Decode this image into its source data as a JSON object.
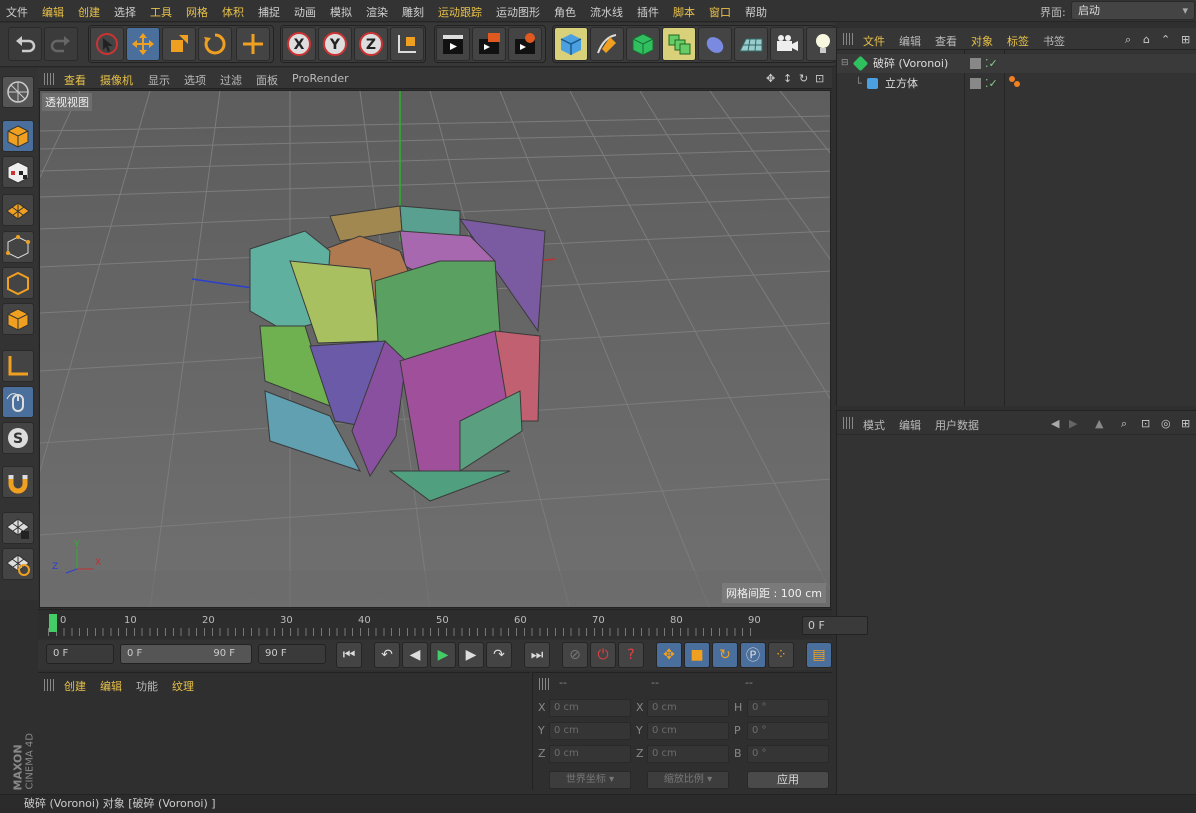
{
  "menubar": {
    "items": [
      "文件",
      "编辑",
      "创建",
      "选择",
      "工具",
      "网格",
      "体积",
      "捕捉",
      "动画",
      "模拟",
      "渲染",
      "雕刻",
      "运动跟踪",
      "运动图形",
      "角色",
      "流水线",
      "插件",
      "脚本",
      "窗口",
      "帮助"
    ],
    "highlight": [
      "编辑",
      "创建",
      "工具",
      "网格",
      "体积",
      "运动跟踪",
      "脚本",
      "窗口"
    ],
    "layout_label": "界面:",
    "layout_value": "启动"
  },
  "toolbar": {
    "icons": [
      "undo-icon",
      "redo-icon",
      "live-select-icon",
      "move-icon",
      "scale-icon",
      "rotate-icon",
      "transform-icon",
      "x-axis-icon",
      "y-axis-icon",
      "z-axis-icon",
      "coordinate-system-icon",
      "render-view-icon",
      "render-picture-viewer-icon",
      "render-settings-icon",
      "cube-primitive-icon",
      "pen-spline-icon",
      "subdivision-icon",
      "array-icon",
      "deformer-icon",
      "floor-icon",
      "camera-icon",
      "light-icon"
    ]
  },
  "left_toolbar": {
    "icons": [
      "make-editable-icon",
      "model-mode-icon",
      "texture-mode-icon",
      "workplane-icon",
      "points-mode-icon",
      "edges-mode-icon",
      "polygons-mode-icon",
      "axis-mode-icon",
      "tweak-mode-icon",
      "solo-icon",
      "snap-icon",
      "workplane-lock-icon",
      "workplane-align-icon"
    ]
  },
  "viewport": {
    "menu": [
      "查看",
      "摄像机",
      "显示",
      "选项",
      "过滤",
      "面板",
      "ProRender"
    ],
    "menu_highlight": [
      "查看",
      "摄像机"
    ],
    "label": "透视视图",
    "grid_spacing": "网格间距 : 100 cm",
    "axis": {
      "x": "X",
      "y": "Y",
      "z": "Z"
    }
  },
  "timeline": {
    "ticks": [
      "0",
      "10",
      "20",
      "30",
      "40",
      "50",
      "60",
      "70",
      "80",
      "90"
    ],
    "current_frame": "0 F"
  },
  "transport": {
    "start": "0 F",
    "range_start": "0 F",
    "range_end": "90 F",
    "end": "90 F"
  },
  "material_panel": {
    "menu": [
      "创建",
      "编辑",
      "功能",
      "纹理"
    ],
    "menu_highlight": [
      "创建",
      "编辑",
      "纹理"
    ]
  },
  "coords": {
    "headers": [
      "--",
      "--",
      "--"
    ],
    "rows": [
      {
        "l1": "X",
        "v1": "0 cm",
        "l2": "X",
        "v2": "0 cm",
        "l3": "H",
        "v3": "0 °"
      },
      {
        "l1": "Y",
        "v1": "0 cm",
        "l2": "Y",
        "v2": "0 cm",
        "l3": "P",
        "v3": "0 °"
      },
      {
        "l1": "Z",
        "v1": "0 cm",
        "l2": "Z",
        "v2": "0 cm",
        "l3": "B",
        "v3": "0 °"
      }
    ],
    "world_coords": "世界坐标",
    "scale_ratio": "缩放比例",
    "apply": "应用"
  },
  "object_manager": {
    "menu": [
      "文件",
      "编辑",
      "查看",
      "对象",
      "标签",
      "书签"
    ],
    "menu_highlight": [
      "文件",
      "对象",
      "标签"
    ],
    "objects": [
      {
        "name": "破碎 (Voronoi)",
        "icon": "voronoi-fracture-icon"
      },
      {
        "name": "立方体",
        "icon": "cube-object-icon"
      }
    ]
  },
  "attribute_manager": {
    "menu": [
      "模式",
      "编辑",
      "用户数据"
    ]
  },
  "brand": {
    "maxon": "MAXON",
    "product": "CINEMA 4D"
  },
  "statusbar": {
    "text": "破碎 (Voronoi) 对象 [破碎 (Voronoi) ]"
  },
  "colors": {
    "accent": "#e8c14a",
    "selection": "#4a6f9c",
    "viewport_bg": "#6b6b6b"
  }
}
